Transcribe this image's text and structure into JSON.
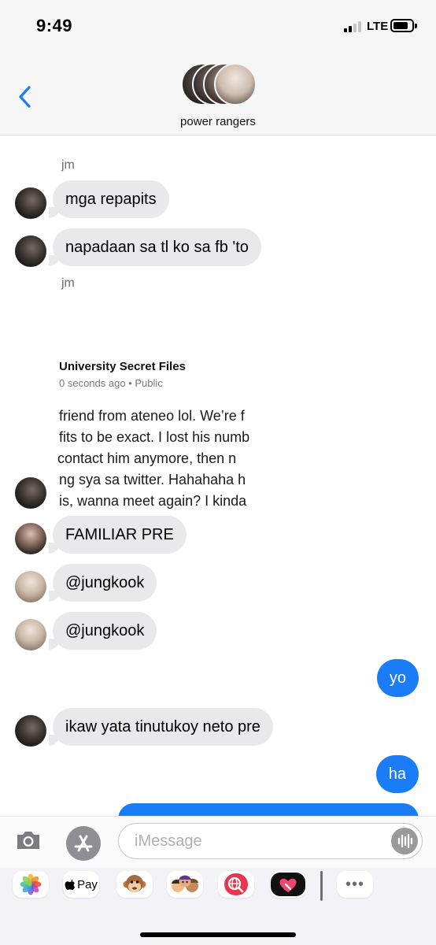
{
  "status_bar": {
    "time": "9:49",
    "network": "LTE"
  },
  "header": {
    "group_name": "power rangers"
  },
  "messages": {
    "sender1": "jm",
    "m1": "mga repapits",
    "m2": "napadaan sa tl ko sa fb 'to",
    "sender2": "jm",
    "post": {
      "title": "University Secret Files",
      "meta": "0 seconds ago • Public",
      "lines": [
        "friend from ateneo lol. We’re f",
        "fits to be exact. I lost his numb",
        " contact him anymore, then n",
        "ng sya sa twitter. Hahahaha h",
        "is, wanna meet again? I kinda"
      ]
    },
    "m3": "FAMILIAR PRE",
    "m4": "@jungkook",
    "m5": "@jungkook",
    "out1": "yo",
    "m6": "ikaw yata tinutukoy neto pre",
    "out2": "ha"
  },
  "input": {
    "placeholder": "iMessage"
  },
  "app_drawer": {
    "apple_pay_label": "Pay",
    "more_label": "•••"
  },
  "colors": {
    "incoming_bubble": "#e9e9eb",
    "outgoing_bubble": "#1a7cf7",
    "header_bg": "#f6f6f6"
  }
}
